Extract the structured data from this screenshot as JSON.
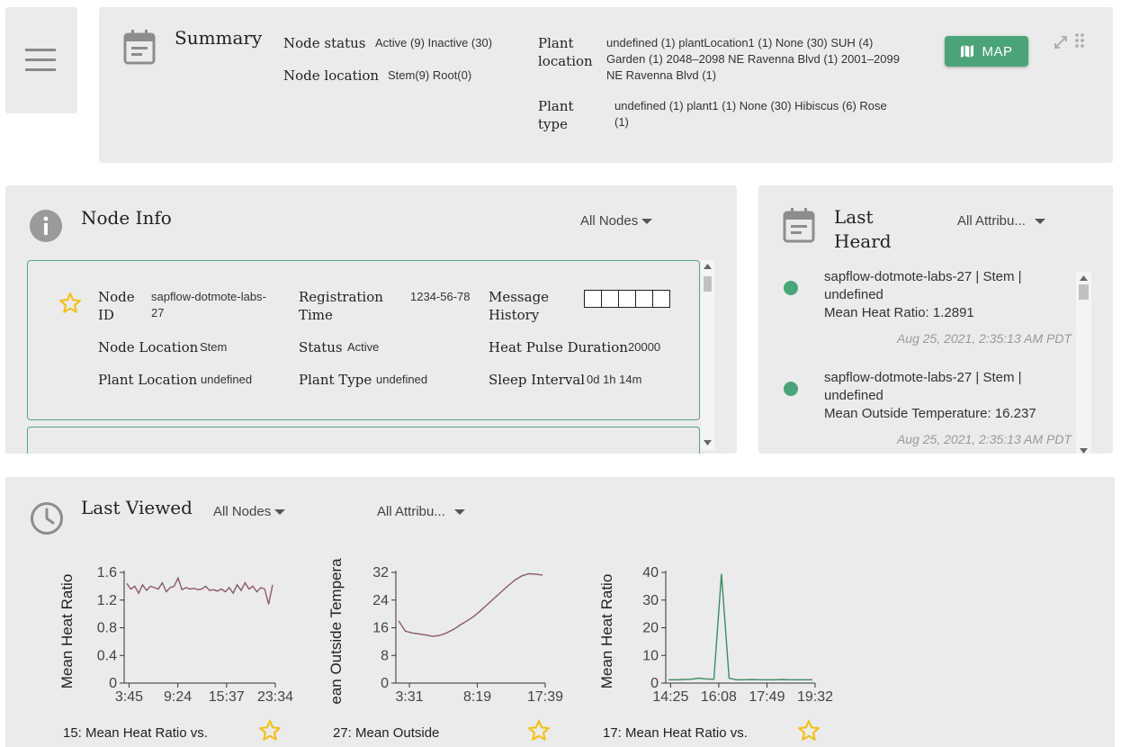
{
  "summary": {
    "title": "Summary",
    "node_status_label": "Node status",
    "node_status_value": "Active (9) Inactive (30)",
    "node_location_label": "Node location",
    "node_location_value": "Stem(9) Root(0)",
    "plant_location_label": "Plant location",
    "plant_location_value": "undefined (1) plantLocation1 (1) None (30) SUH (4) Garden (1) 2048–2098 NE Ravenna Blvd (1) 2001–2099 NE Ravenna Blvd (1)",
    "plant_type_label": "Plant type",
    "plant_type_value": "undefined (1) plant1 (1) None (30) Hibiscus (6) Rose (1)",
    "map_button": "MAP"
  },
  "node_info": {
    "title": "Node Info",
    "filter": "All Nodes",
    "card": {
      "node_id_label": "Node ID",
      "node_id_value": "sapflow-dotmote-labs-27",
      "registration_label": "Registration Time",
      "registration_value": "1234-56-78",
      "message_history_label": "Message History",
      "node_location_label": "Node Location",
      "node_location_value": "Stem",
      "status_label": "Status",
      "status_value": "Active",
      "heat_pulse_label": "Heat Pulse Duration",
      "heat_pulse_value": "20000",
      "plant_location_label": "Plant Location",
      "plant_location_value": "undefined",
      "plant_type_label": "Plant Type",
      "plant_type_value": "undefined",
      "sleep_label": "Sleep Interval",
      "sleep_value": "0d 1h 14m"
    }
  },
  "last_heard": {
    "title": "Last Heard",
    "filter": "All Attribu...",
    "items": [
      {
        "node": "sapflow-dotmote-labs-27 | Stem | undefined",
        "metric": "Mean Heat Ratio: 1.2891",
        "time": "Aug 25, 2021, 2:35:13 AM PDT"
      },
      {
        "node": "sapflow-dotmote-labs-27 | Stem | undefined",
        "metric": "Mean Outside Temperature: 16.237",
        "time": "Aug 25, 2021, 2:35:13 AM PDT"
      }
    ]
  },
  "last_viewed": {
    "title": "Last Viewed",
    "filter_nodes": "All Nodes",
    "filter_attrs": "All Attribu...",
    "captions": [
      "15: Mean Heat Ratio vs.",
      "27: Mean Outside",
      "17: Mean Heat Ratio vs."
    ]
  },
  "colors": {
    "accent": "#4aa477",
    "panel": "#ebebeb",
    "series_purple": "#8a5a6e",
    "series_green": "#3f8a64",
    "star": "#f2c01e"
  },
  "chart_data": [
    {
      "type": "line",
      "ylabel": "Mean Heat Ratio",
      "ylim": [
        0,
        1.6
      ],
      "yticks": [
        "0",
        "0.4",
        "0.8",
        "1.2",
        "1.6"
      ],
      "xticks": [
        "3:45",
        "9:24",
        "15:37",
        "23:34"
      ],
      "series": [
        {
          "values": [
            1.44,
            1.36,
            1.4,
            1.3,
            1.42,
            1.34,
            1.4,
            1.38,
            1.36,
            1.45,
            1.32,
            1.38,
            1.4,
            1.52,
            1.35,
            1.38,
            1.36,
            1.37,
            1.35,
            1.36,
            1.4,
            1.34,
            1.35,
            1.33,
            1.36,
            1.32,
            1.38,
            1.3,
            1.42,
            1.34,
            1.45,
            1.36,
            1.4,
            1.32,
            1.38,
            1.36,
            1.14,
            1.42
          ]
        }
      ]
    },
    {
      "type": "line",
      "ylabel": "ean Outside Tempera",
      "ylim": [
        0,
        32
      ],
      "yticks": [
        "0",
        "8",
        "16",
        "24",
        "32"
      ],
      "xticks": [
        "3:31",
        "8:19",
        "17:39"
      ],
      "series": [
        {
          "values": [
            18,
            15,
            14.5,
            14.2,
            13.9,
            13.5,
            13.8,
            14.5,
            15.5,
            16.8,
            18,
            19.3,
            21,
            22.8,
            24.6,
            26.4,
            28.2,
            29.8,
            31,
            31.6,
            31.5,
            31.2
          ]
        }
      ]
    },
    {
      "type": "line",
      "ylabel": "Mean Heat Ratio",
      "ylim": [
        0,
        40
      ],
      "yticks": [
        "0",
        "10",
        "20",
        "30",
        "40"
      ],
      "xticks": [
        "14:25",
        "16:08",
        "17:49",
        "19:32"
      ],
      "series": [
        {
          "values": [
            1.2,
            1.2,
            1.3,
            1.4,
            1.8,
            1.5,
            1.4,
            39.5,
            1.8,
            1.2,
            1.2,
            1.3,
            1.2,
            1.2,
            1.2,
            1.3,
            1.2,
            1.2,
            1.2,
            1.2
          ]
        }
      ]
    }
  ]
}
